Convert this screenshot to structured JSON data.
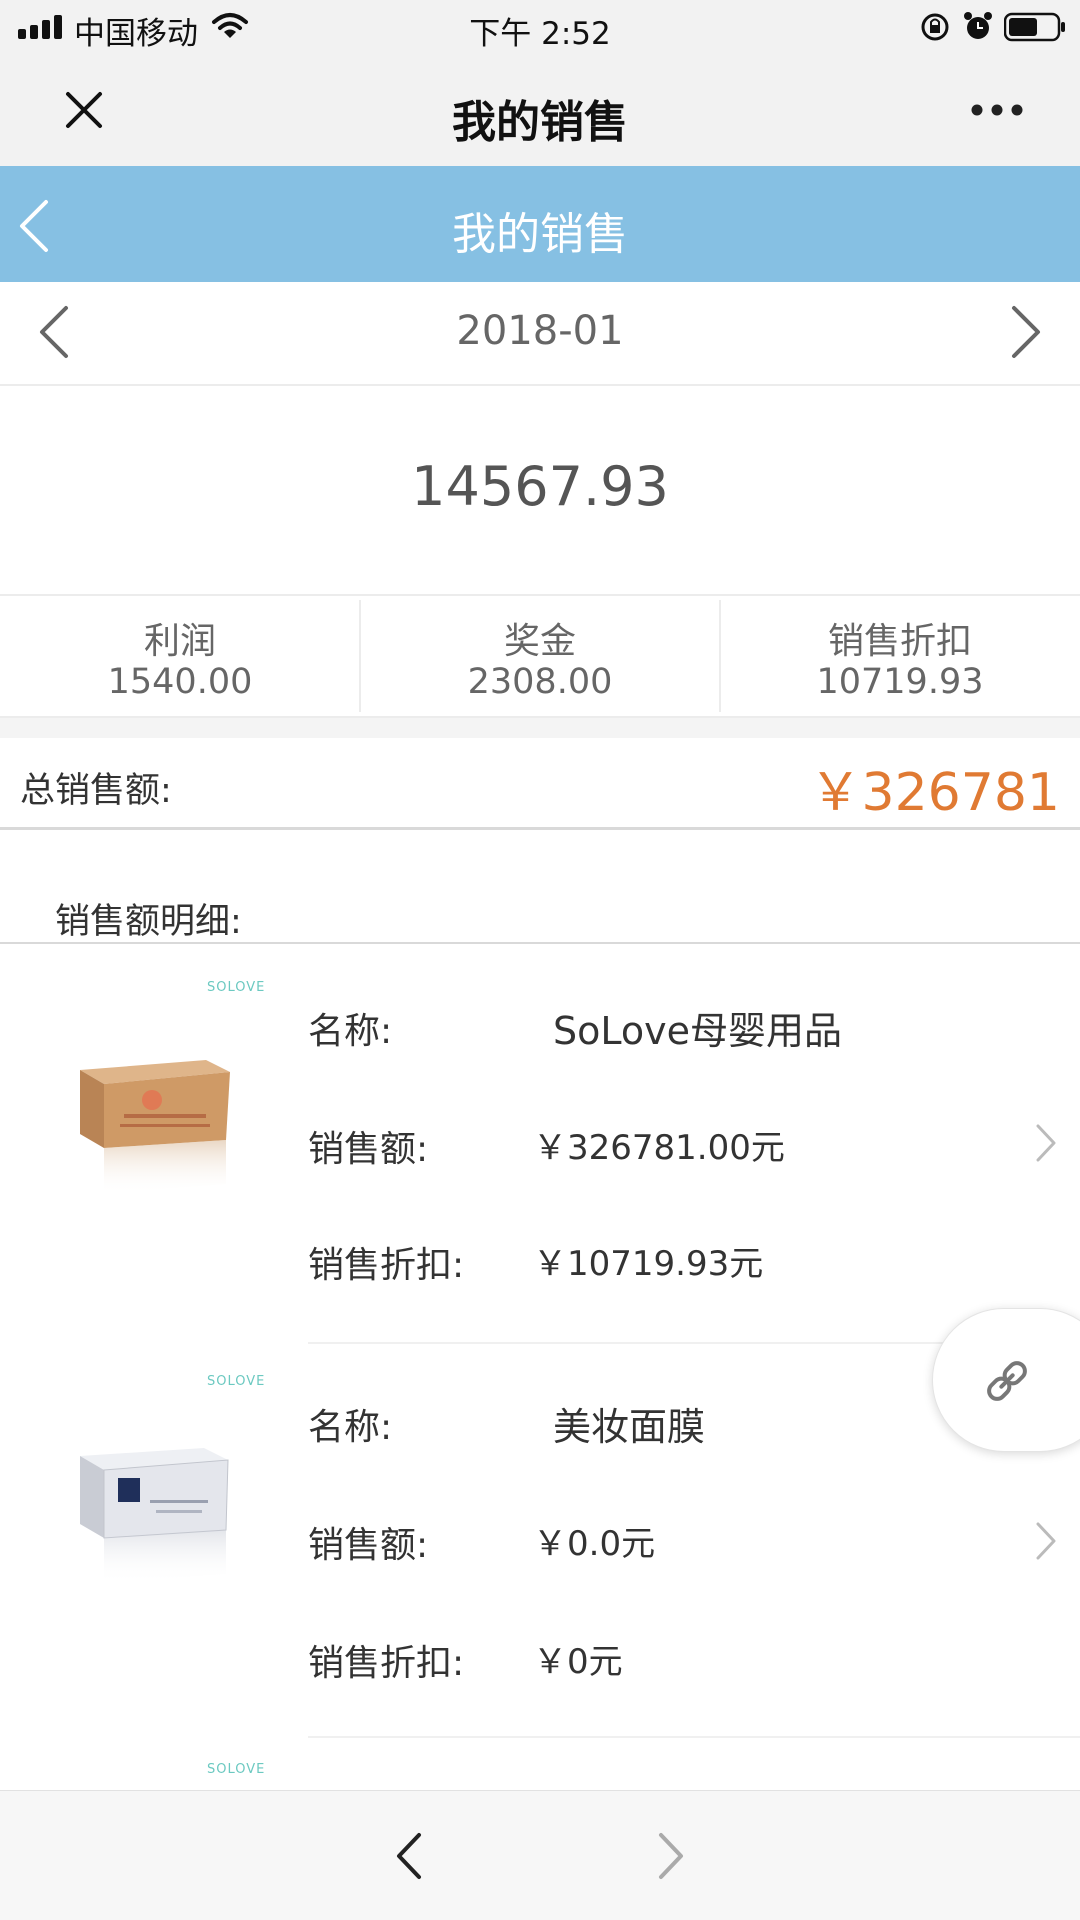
{
  "status_bar": {
    "carrier": "中国移动",
    "time": "下午 2:52"
  },
  "wechat_nav": {
    "title": "我的销售"
  },
  "app_header": {
    "title": "我的销售"
  },
  "period": {
    "month": "2018-01"
  },
  "summary": {
    "big_number": "14567.93"
  },
  "stats": [
    {
      "label": "利润",
      "value": "1540.00"
    },
    {
      "label": "奖金",
      "value": "2308.00"
    },
    {
      "label": "销售折扣",
      "value": "10719.93"
    }
  ],
  "total": {
    "label": "总销售额:",
    "value": "￥326781"
  },
  "detail": {
    "title": "销售额明细:"
  },
  "products": [
    {
      "brand": "SOLOVE",
      "name_label": "名称:",
      "name": "SoLove母婴用品",
      "sales_label": "销售额:",
      "sales": "￥326781.00元",
      "discount_label": "销售折扣:",
      "discount": "￥10719.93元"
    },
    {
      "brand": "SOLOVE",
      "name_label": "名称:",
      "name": "美妆面膜",
      "sales_label": "销售额:",
      "sales": "￥0.0元",
      "discount_label": "销售折扣:",
      "discount": "￥0元"
    },
    {
      "brand": "SOLOVE"
    }
  ],
  "colors": {
    "header_blue": "#86c0e3",
    "accent_orange": "#e07a33",
    "brand_teal": "#6cc9c1"
  },
  "icons": [
    "signal-icon",
    "wifi-icon",
    "orientation-lock-icon",
    "alarm-icon",
    "battery-icon",
    "close-icon",
    "more-icon",
    "back-icon",
    "prev-month-icon",
    "next-month-icon",
    "chevron-right-icon",
    "link-icon",
    "nav-back-icon",
    "nav-forward-icon"
  ]
}
